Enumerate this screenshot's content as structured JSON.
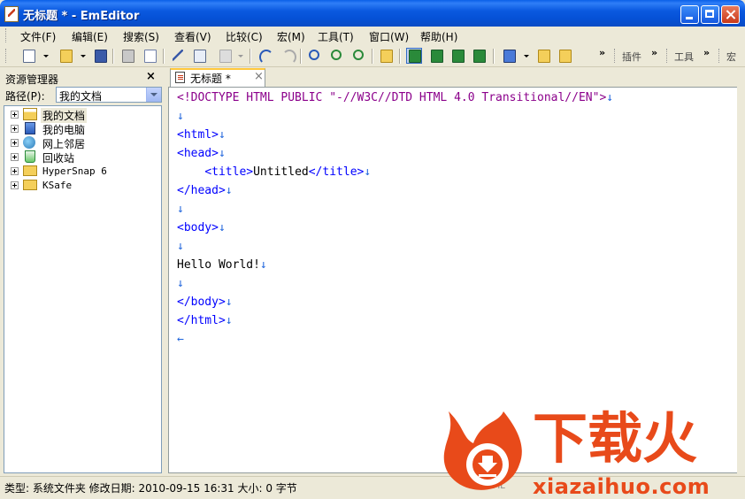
{
  "window": {
    "title": "无标题 * - EmEditor"
  },
  "menu": {
    "items": [
      "文件(F)",
      "编辑(E)",
      "搜索(S)",
      "查看(V)",
      "比较(C)",
      "宏(M)",
      "工具(T)",
      "窗口(W)",
      "帮助(H)"
    ]
  },
  "toolbar": {
    "plugins_label": "插件",
    "tools_label": "工具",
    "macros_label": "宏",
    "overflow": "»"
  },
  "sidebar": {
    "title": "资源管理器",
    "close": "×",
    "path_label": "路径(P):",
    "path_value": "我的文档",
    "tree": [
      {
        "label": "我的文档",
        "icon": "documents-folder-icon"
      },
      {
        "label": "我的电脑",
        "icon": "computer-icon"
      },
      {
        "label": "网上邻居",
        "icon": "network-icon"
      },
      {
        "label": "回收站",
        "icon": "recycle-bin-icon"
      },
      {
        "label": "HyperSnap 6",
        "icon": "folder-icon"
      },
      {
        "label": "KSafe",
        "icon": "folder-icon"
      }
    ]
  },
  "tabs": [
    {
      "label": "无标题 *",
      "close": "×"
    }
  ],
  "editor": {
    "lines": [
      {
        "parts": [
          [
            "doctype",
            "<!DOCTYPE HTML PUBLIC "
          ],
          [
            "str",
            "\"-//W3C//DTD HTML 4.0 Transitional//EN\""
          ],
          [
            "doctype",
            ">"
          ],
          [
            "nl",
            "↓"
          ]
        ]
      },
      {
        "parts": [
          [
            "nl",
            "↓"
          ]
        ]
      },
      {
        "parts": [
          [
            "tag",
            "<html>"
          ],
          [
            "nl",
            "↓"
          ]
        ]
      },
      {
        "parts": [
          [
            "tag",
            "<head>"
          ],
          [
            "nl",
            "↓"
          ]
        ]
      },
      {
        "parts": [
          [
            "text",
            "    "
          ],
          [
            "tag",
            "<title>"
          ],
          [
            "text",
            "Untitled"
          ],
          [
            "tag",
            "</title>"
          ],
          [
            "nl",
            "↓"
          ]
        ]
      },
      {
        "parts": [
          [
            "tag",
            "</head>"
          ],
          [
            "nl",
            "↓"
          ]
        ]
      },
      {
        "parts": [
          [
            "nl",
            "↓"
          ]
        ]
      },
      {
        "parts": [
          [
            "tag",
            "<body>"
          ],
          [
            "nl",
            "↓"
          ]
        ]
      },
      {
        "parts": [
          [
            "nl",
            "↓"
          ]
        ]
      },
      {
        "parts": [
          [
            "text",
            "Hello World!"
          ],
          [
            "nl",
            "↓"
          ]
        ]
      },
      {
        "parts": [
          [
            "nl",
            "↓"
          ]
        ]
      },
      {
        "parts": [
          [
            "tag",
            "</body>"
          ],
          [
            "nl",
            "↓"
          ]
        ]
      },
      {
        "parts": [
          [
            "tag",
            "</html>"
          ],
          [
            "nl",
            "↓"
          ]
        ]
      },
      {
        "parts": [
          [
            "nl",
            "←"
          ]
        ]
      }
    ]
  },
  "status": {
    "text": "类型: 系统文件夹 修改日期: 2010-09-15 16:31 大小: 0 字节",
    "right": "HTML"
  },
  "watermark": {
    "brand": "下载火",
    "site": "xiazaihuo.com",
    "color": "#e84a1a"
  },
  "colors": {
    "titlebar": "#0a5fe8",
    "tag": "#0000ff",
    "doctype": "#8b008b",
    "newline_marker": "#1e64dc"
  }
}
